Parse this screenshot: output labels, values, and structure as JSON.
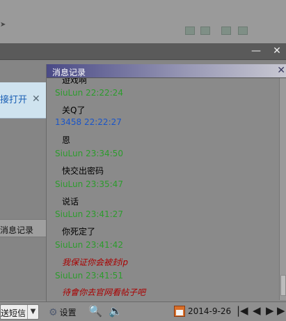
{
  "left_pane": {
    "notify_text": "接打开",
    "close_glyph": "✕",
    "messages_label": "消息记录"
  },
  "panel": {
    "title": "消息记录",
    "close_glyph": "✕"
  },
  "messages": [
    {
      "text": "遊戏啊",
      "kind": "body-black"
    },
    {
      "text": "SiuLun 22:22:24",
      "kind": "sender-g"
    },
    {
      "text": "关Q了",
      "kind": "body-black"
    },
    {
      "text": "13458 22:22:27",
      "kind": "sender-b"
    },
    {
      "text": "恩",
      "kind": "body-black"
    },
    {
      "text": "SiuLun 23:34:50",
      "kind": "sender-g"
    },
    {
      "text": "快交出密码",
      "kind": "body-black"
    },
    {
      "text": "SiuLun 23:35:47",
      "kind": "sender-g"
    },
    {
      "text": "说话",
      "kind": "body-black"
    },
    {
      "text": "SiuLun 23:41:27",
      "kind": "sender-g"
    },
    {
      "text": "你死定了",
      "kind": "body-black"
    },
    {
      "text": "SiuLun 23:41:42",
      "kind": "sender-g"
    },
    {
      "text": "我保证你会被封ip",
      "kind": "body-red"
    },
    {
      "text": "SiuLun 23:41:51",
      "kind": "sender-g"
    },
    {
      "text": "待會你去官网看帖子吧",
      "kind": "body-red"
    }
  ],
  "window": {
    "minimize_glyph": "—",
    "close_glyph": "✕"
  },
  "toolbar": {
    "send_label": "送短信",
    "dropdown_glyph": "▼",
    "settings_label": "设置",
    "settings_icon": "⚙",
    "find_icon": "🔍",
    "sound_icon": "🔈",
    "date": "2014-9-26",
    "nav_first": "|◀",
    "nav_prev": "◀",
    "nav_next": "▶",
    "nav_last": "▶|"
  }
}
